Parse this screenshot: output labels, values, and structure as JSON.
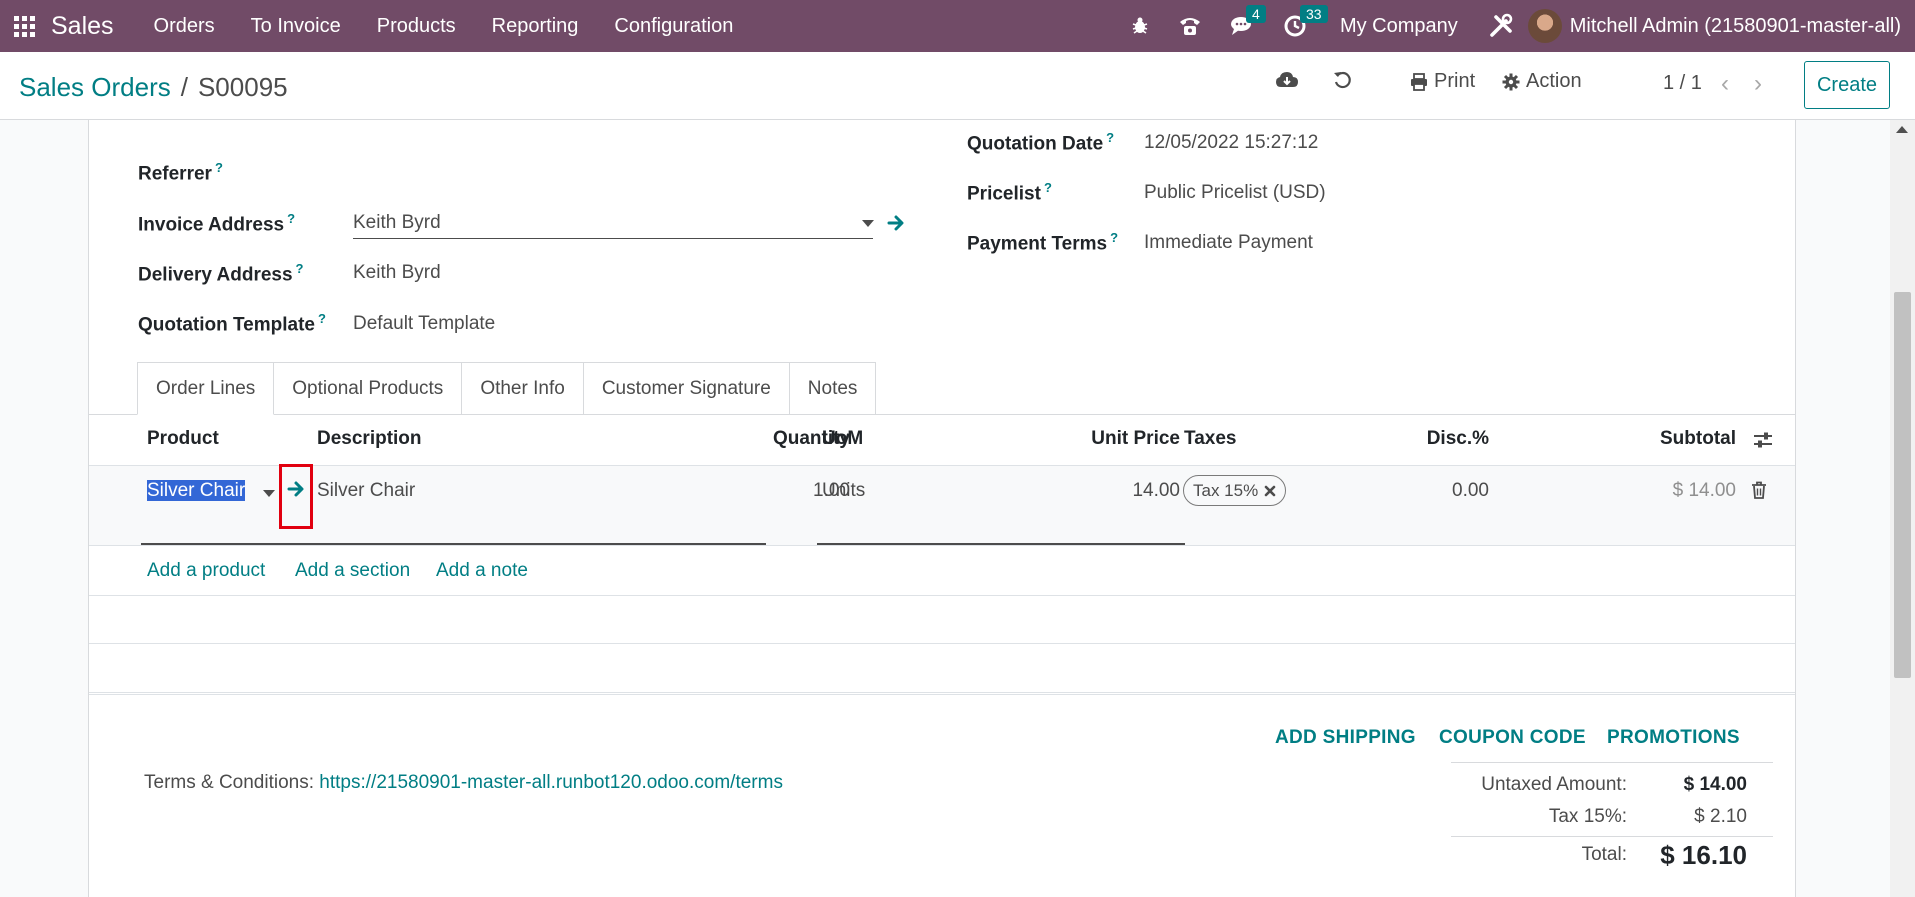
{
  "navbar": {
    "app_name": "Sales",
    "menu": [
      "Orders",
      "To Invoice",
      "Products",
      "Reporting",
      "Configuration"
    ],
    "messages_count": "4",
    "activities_count": "33",
    "company": "My Company",
    "user": "Mitchell Admin (21580901-master-all)"
  },
  "breadcrumb": {
    "parent": "Sales Orders",
    "separator": "/",
    "current": "S00095"
  },
  "control": {
    "print_label": "Print",
    "action_label": "Action",
    "pager": "1 / 1",
    "create_label": "Create"
  },
  "form": {
    "referrer_label": "Referrer",
    "invoice_address_label": "Invoice Address",
    "invoice_address_value": "Keith Byrd",
    "delivery_address_label": "Delivery Address",
    "delivery_address_value": "Keith Byrd",
    "quotation_template_label": "Quotation Template",
    "quotation_template_value": "Default Template",
    "quotation_date_label": "Quotation Date",
    "quotation_date_value": "12/05/2022 15:27:12",
    "pricelist_label": "Pricelist",
    "pricelist_value": "Public Pricelist (USD)",
    "payment_terms_label": "Payment Terms",
    "payment_terms_value": "Immediate Payment",
    "help_mark": "?"
  },
  "tabs": [
    "Order Lines",
    "Optional Products",
    "Other Info",
    "Customer Signature",
    "Notes"
  ],
  "order_lines": {
    "headers": {
      "product": "Product",
      "description": "Description",
      "quantity": "Quantity",
      "uom": "UoM",
      "unit_price": "Unit Price",
      "taxes": "Taxes",
      "discount": "Disc.%",
      "subtotal": "Subtotal"
    },
    "row": {
      "product": "Silver Chair",
      "description": "Silver Chair",
      "quantity": "1.00",
      "uom": "Units",
      "unit_price": "14.00",
      "tax": "Tax 15%",
      "discount": "0.00",
      "subtotal": "$ 14.00"
    },
    "add_product": "Add a product",
    "add_section": "Add a section",
    "add_note": "Add a note"
  },
  "footer": {
    "add_shipping": "ADD SHIPPING",
    "coupon_code": "COUPON CODE",
    "promotions": "PROMOTIONS",
    "terms_label": "Terms & Conditions:",
    "terms_url": "https://21580901-master-all.runbot120.odoo.com/terms",
    "untaxed_label": "Untaxed Amount:",
    "untaxed_value": "$ 14.00",
    "tax_label": "Tax 15%:",
    "tax_value": "$ 2.10",
    "total_label": "Total:",
    "total_value": "$ 16.10"
  },
  "colors": {
    "navbar": "#714b67",
    "accent": "#017e84",
    "highlight": "#e1000f"
  }
}
